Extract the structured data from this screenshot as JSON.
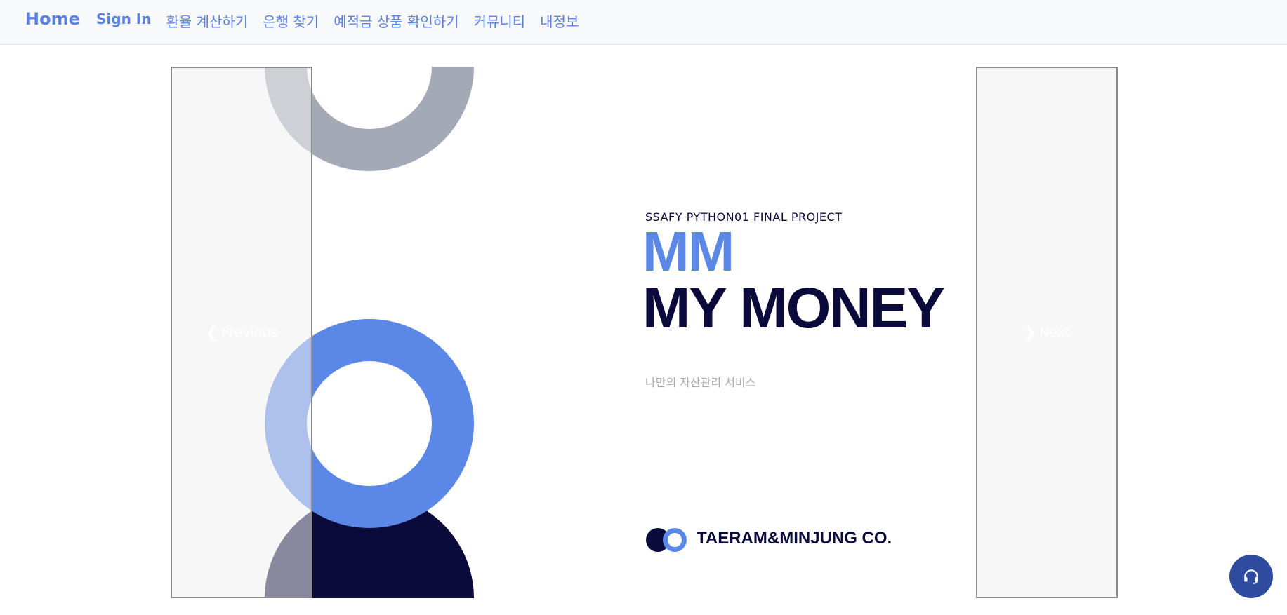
{
  "navbar": {
    "brand": "Home",
    "links": [
      {
        "label": "Sign In"
      },
      {
        "label": "환율 계산하기"
      },
      {
        "label": "은행 찾기"
      },
      {
        "label": "예적금 상품 확인하기"
      },
      {
        "label": "커뮤니티"
      },
      {
        "label": "내정보"
      }
    ]
  },
  "slide": {
    "subtitle": "SSAFY PYTHON01 FINAL PROJECT",
    "title_short": "MM",
    "title_full": "MY MONEY",
    "tagline": "나만의 자산관리 서비스",
    "company": "TAERAM&MINJUNG CO."
  },
  "carousel": {
    "prev_label": "Previous",
    "next_label": "Next"
  },
  "colors": {
    "accent": "#5b82e0",
    "navy": "#0b0b3b",
    "blue": "#5b88e6",
    "gray_ring": "#a4a9b6",
    "chat_button": "#2f4ba0"
  },
  "icons": {
    "prev": "chevron-left-icon",
    "next": "chevron-right-icon",
    "chat": "headset-icon"
  }
}
